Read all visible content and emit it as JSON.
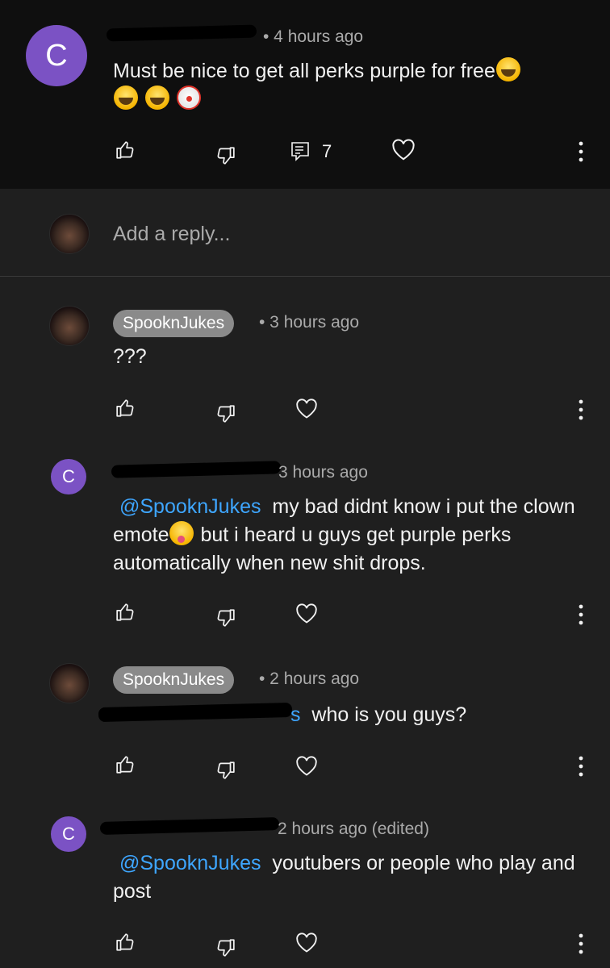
{
  "colors": {
    "accent_mention": "#3ea6ff",
    "avatar_bg": "#7b52c4",
    "top_bg": "#0f0f0f",
    "page_bg": "#1f1f1f"
  },
  "parent": {
    "avatar_letter": "C",
    "meta": "• 4 hours ago",
    "text": "Must be nice to get all perks purple for free",
    "emojis": [
      "face-with-tears-of-joy",
      "face-with-tears-of-joy",
      "face-with-tears-of-joy",
      "clown-face"
    ],
    "reply_count": "7",
    "icons": [
      "like-icon",
      "dislike-icon",
      "replies-icon",
      "heart-icon",
      "more-icon"
    ]
  },
  "reply_box": {
    "placeholder": "Add a reply..."
  },
  "replies": [
    {
      "author": "SpooknJukes",
      "meta": "• 3 hours ago",
      "text": "???"
    },
    {
      "avatar_letter": "C",
      "meta": "3 hours ago",
      "mention": "@SpooknJukes",
      "text_a": "my bad didnt know i put the clown emote",
      "emoji": "squinting-face-with-tongue",
      "text_b": "but i heard u guys get purple perks automatically when new shit drops."
    },
    {
      "author": "SpooknJukes",
      "meta": "• 2 hours ago",
      "mention_partial": "s",
      "text": "who is you guys?"
    },
    {
      "avatar_letter": "C",
      "meta": "2 hours ago (edited)",
      "mention": "@SpooknJukes",
      "text": "youtubers or people who play and post"
    }
  ]
}
